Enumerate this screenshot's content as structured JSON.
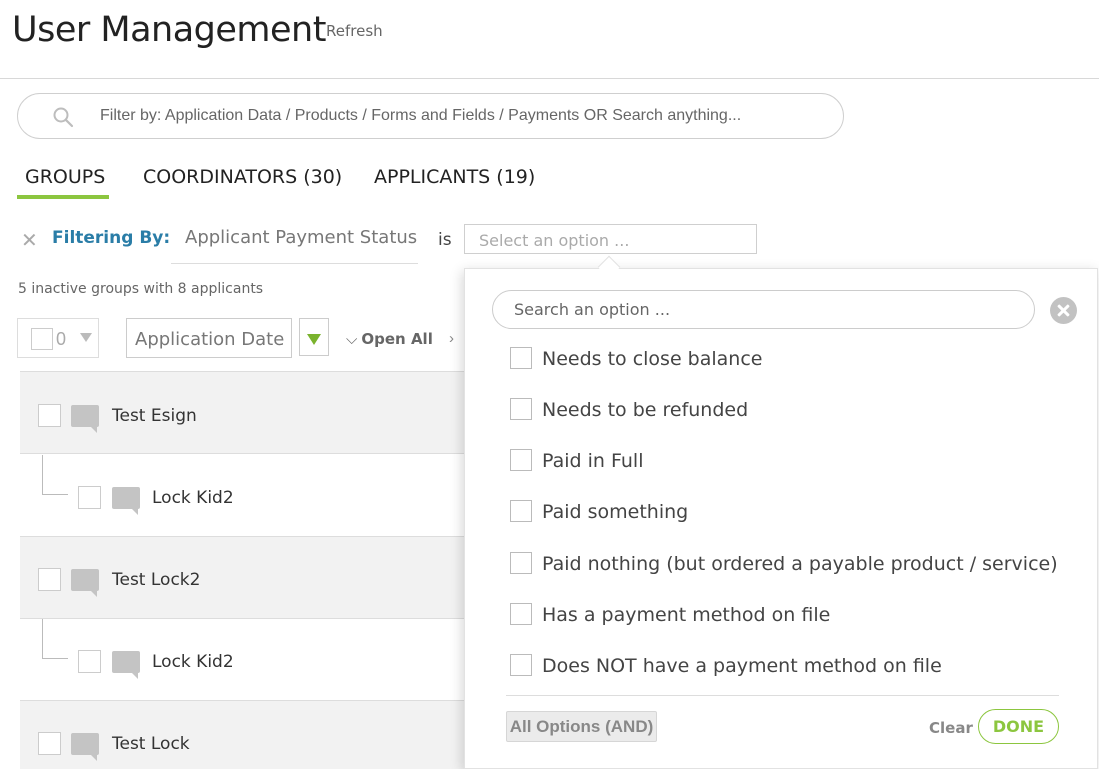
{
  "header": {
    "title": "User Management",
    "refresh_label": "Refresh"
  },
  "search": {
    "placeholder": "Filter by: Application Data / Products / Forms and Fields / Payments OR Search anything..."
  },
  "tabs": [
    {
      "label": "GROUPS",
      "active": true
    },
    {
      "label": "COORDINATORS (30)",
      "active": false
    },
    {
      "label": "APPLICANTS (19)",
      "active": false
    }
  ],
  "filter": {
    "label": "Filtering By:",
    "field": "Applicant Payment Status",
    "operator": "is",
    "select_placeholder": "Select an option ..."
  },
  "summary": "5 inactive groups with 8 applicants",
  "toolbar": {
    "selected_count": "0",
    "sort_field": "Application Date",
    "open_all_label": "Open All"
  },
  "rows": [
    {
      "name": "Test Esign",
      "type": "group"
    },
    {
      "name": "Lock Kid2",
      "type": "child"
    },
    {
      "name": "Test Lock2",
      "type": "group"
    },
    {
      "name": "Lock Kid2",
      "type": "child"
    },
    {
      "name": "Test Lock",
      "type": "group"
    }
  ],
  "dropdown": {
    "search_placeholder": "Search an option ...",
    "options": [
      "Needs to close balance",
      "Needs to be refunded",
      "Paid in Full",
      "Paid something",
      "Paid nothing (but ordered a payable product / service)",
      "Has a payment method on file",
      "Does NOT have a payment method on file"
    ],
    "mode_label": "All Options (AND)",
    "clear_label": "Clear",
    "done_label": "DONE"
  },
  "colors": {
    "accent_green": "#8cc63f",
    "link_blue": "#2a7da7"
  }
}
